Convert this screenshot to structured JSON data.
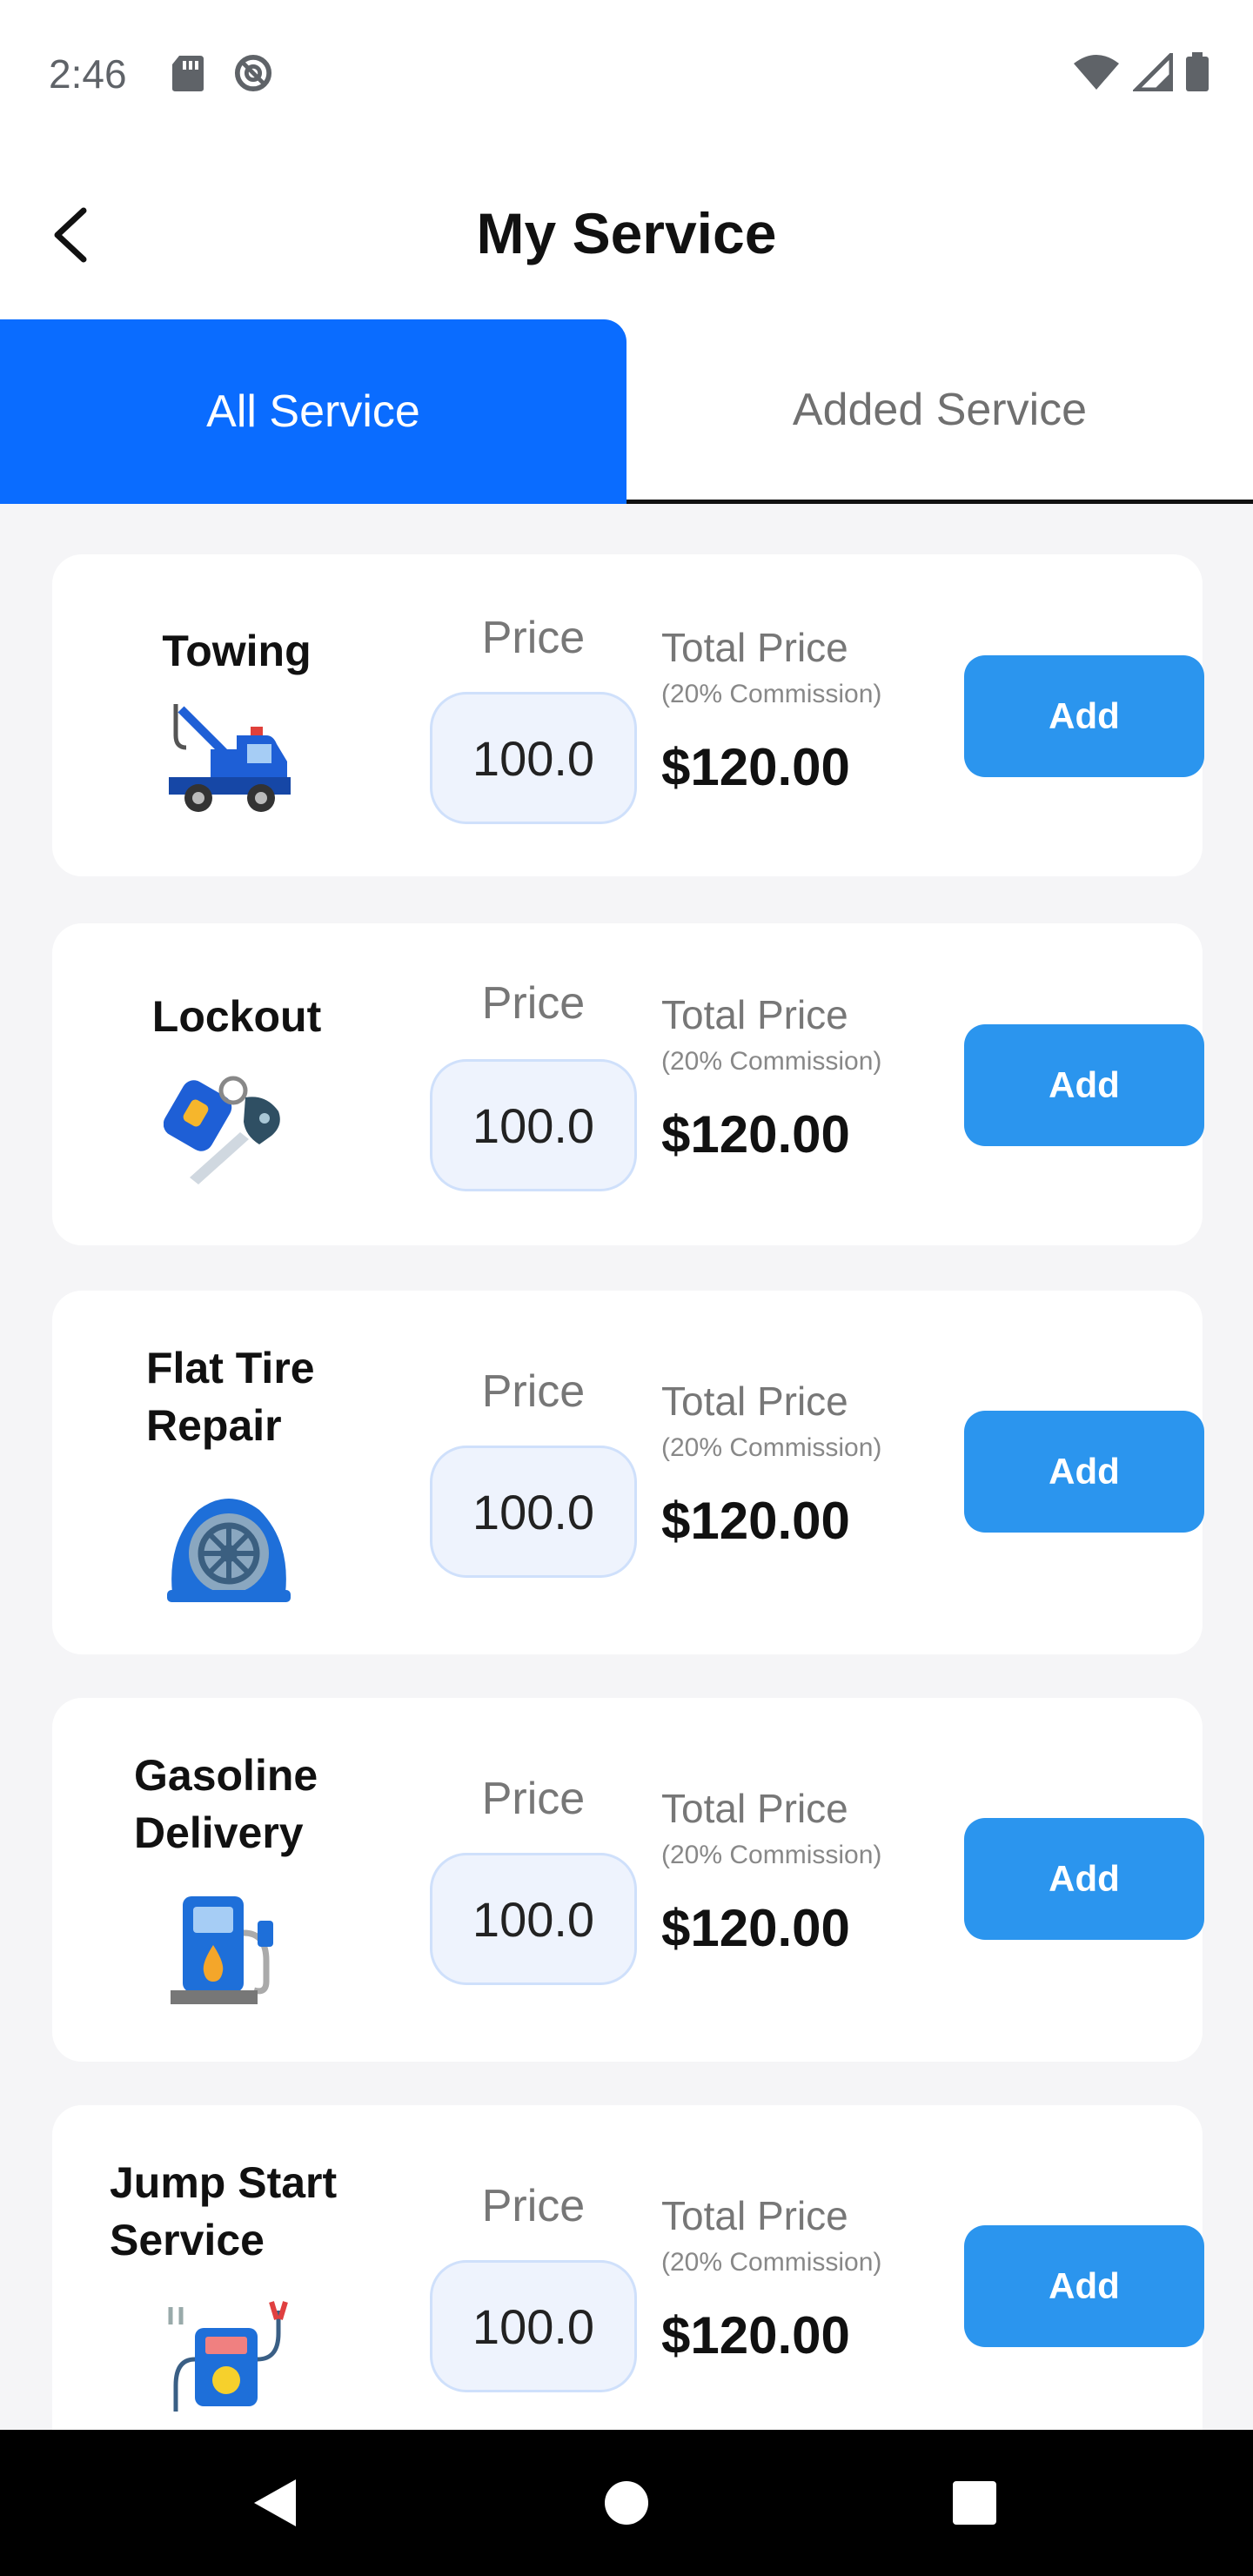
{
  "status_bar": {
    "time": "2:46",
    "icons": [
      "sd-card-icon",
      "do-not-disturb-icon",
      "wifi-icon",
      "signal-icon",
      "battery-icon"
    ]
  },
  "header": {
    "title": "My Service",
    "back_icon": "chevron-left-icon"
  },
  "tabs": [
    {
      "label": "All Service",
      "active": true
    },
    {
      "label": "Added Service",
      "active": false
    }
  ],
  "colors": {
    "accent": "#0a6cff",
    "button": "#2b95ee",
    "input_bg": "#eef3fd"
  },
  "services": [
    {
      "name": "Towing",
      "icon": "tow-truck-icon",
      "price_label": "Price",
      "price": "100.0",
      "total_label": "Total Price",
      "commission": "(20% Commission)",
      "total": "$120.00",
      "button": "Add"
    },
    {
      "name": "Lockout",
      "icon": "car-keys-icon",
      "price_label": "Price",
      "price": "100.0",
      "total_label": "Total Price",
      "commission": "(20% Commission)",
      "total": "$120.00",
      "button": "Add"
    },
    {
      "name": "Flat Tire Repair",
      "icon": "tire-icon",
      "price_label": "Price",
      "price": "100.0",
      "total_label": "Total Price",
      "commission": "(20% Commission)",
      "total": "$120.00",
      "button": "Add"
    },
    {
      "name": "Gasoline Delivery",
      "icon": "fuel-pump-icon",
      "price_label": "Price",
      "price": "100.0",
      "total_label": "Total Price",
      "commission": "(20% Commission)",
      "total": "$120.00",
      "button": "Add"
    },
    {
      "name": "Jump Start Service",
      "icon": "jump-starter-icon",
      "price_label": "Price",
      "price": "100.0",
      "total_label": "Total Price",
      "commission": "(20% Commission)",
      "total": "$120.00",
      "button": "Add"
    }
  ],
  "nav_bar": {
    "buttons": [
      "back-triangle-icon",
      "home-circle-icon",
      "recents-square-icon"
    ]
  }
}
